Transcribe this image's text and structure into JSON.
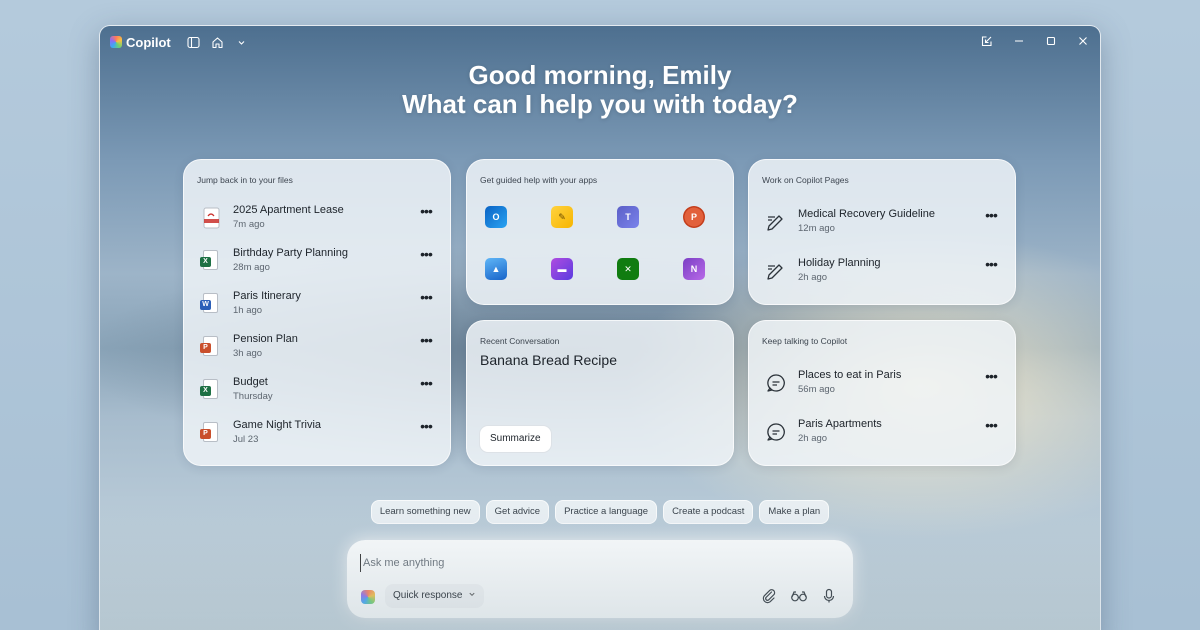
{
  "app": {
    "title": "Copilot"
  },
  "greeting": {
    "line1": "Good morning, Emily",
    "line2": "What can I help you with today?"
  },
  "files_card": {
    "title": "Jump back in to your files",
    "items": [
      {
        "name": "2025 Apartment Lease",
        "time": "7m ago",
        "type": "pdf",
        "tag": ""
      },
      {
        "name": "Birthday Party Planning",
        "time": "28m ago",
        "type": "excel",
        "tag": "X"
      },
      {
        "name": "Paris Itinerary",
        "time": "1h ago",
        "type": "word",
        "tag": "W"
      },
      {
        "name": "Pension Plan",
        "time": "3h ago",
        "type": "powerpoint",
        "tag": "P"
      },
      {
        "name": "Budget",
        "time": "Thursday",
        "type": "excel",
        "tag": "X"
      },
      {
        "name": "Game Night Trivia",
        "time": "Jul 23",
        "type": "powerpoint",
        "tag": "P"
      }
    ],
    "more_label": "•••"
  },
  "apps_card": {
    "title": "Get guided help with your apps",
    "apps": [
      "outlook-icon",
      "sticky-notes-icon",
      "teams-icon",
      "powerpoint-icon",
      "photos-icon",
      "clipchamp-icon",
      "xbox-icon",
      "onenote-icon"
    ]
  },
  "pages_card": {
    "title": "Work on Copilot Pages",
    "items": [
      {
        "name": "Medical Recovery Guideline",
        "time": "12m ago"
      },
      {
        "name": "Holiday Planning",
        "time": "2h ago"
      }
    ]
  },
  "conversation_card": {
    "title": "Recent Conversation",
    "conversation": "Banana Bread Recipe",
    "action": "Summarize"
  },
  "talk_card": {
    "title": "Keep talking to Copilot",
    "items": [
      {
        "name": "Places to eat in Paris",
        "time": "56m ago"
      },
      {
        "name": "Paris Apartments",
        "time": "2h ago"
      }
    ]
  },
  "suggestions": [
    "Learn something new",
    "Get advice",
    "Practice a language",
    "Create a podcast",
    "Make a plan"
  ],
  "composer": {
    "placeholder": "Ask me anything",
    "mode": "Quick response"
  },
  "colors": {
    "excel": "#1d7044",
    "word": "#2b5fb8",
    "powerpoint": "#c94f2c",
    "pdf": "#c9302c"
  }
}
